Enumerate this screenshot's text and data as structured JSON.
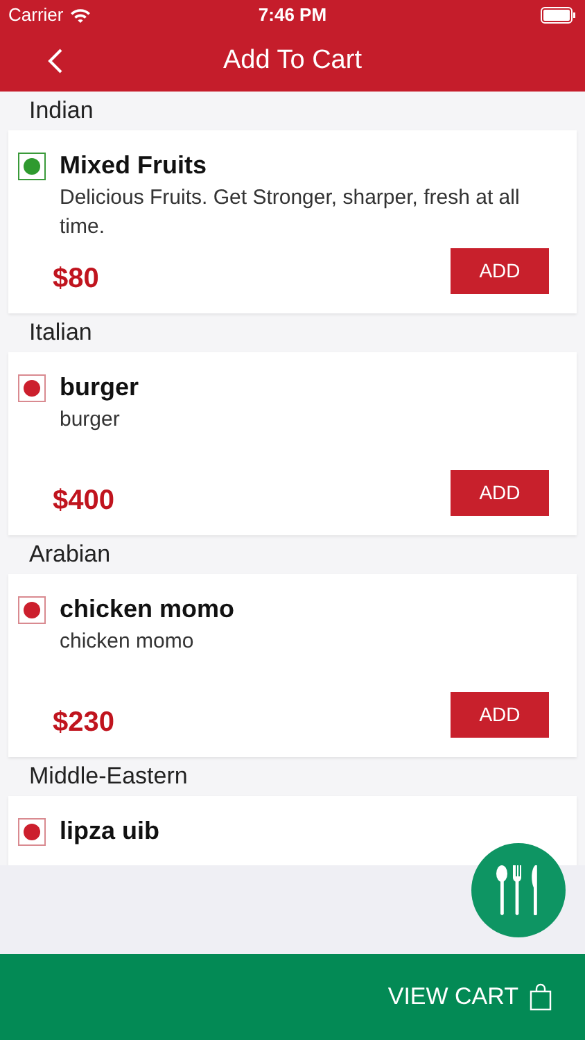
{
  "status_bar": {
    "carrier": "Carrier",
    "time": "7:46 PM"
  },
  "header": {
    "title": "Add To Cart"
  },
  "sections": [
    {
      "title": "Indian",
      "items": [
        {
          "name": "Mixed Fruits",
          "veg": true,
          "description": "Delicious Fruits. Get Stronger, sharper, fresh at all time.",
          "price": "$80",
          "button": "ADD"
        }
      ]
    },
    {
      "title": "Italian",
      "items": [
        {
          "name": "burger",
          "veg": false,
          "description": "burger",
          "price": "$400",
          "button": "ADD"
        }
      ]
    },
    {
      "title": "Arabian",
      "items": [
        {
          "name": "chicken momo",
          "veg": false,
          "description": "chicken momo",
          "price": "$230",
          "button": "ADD"
        }
      ]
    },
    {
      "title": "Middle-Eastern",
      "items": [
        {
          "name": "lipza uib",
          "veg": false
        }
      ]
    }
  ],
  "bottom_bar": {
    "label": "VIEW CART"
  }
}
